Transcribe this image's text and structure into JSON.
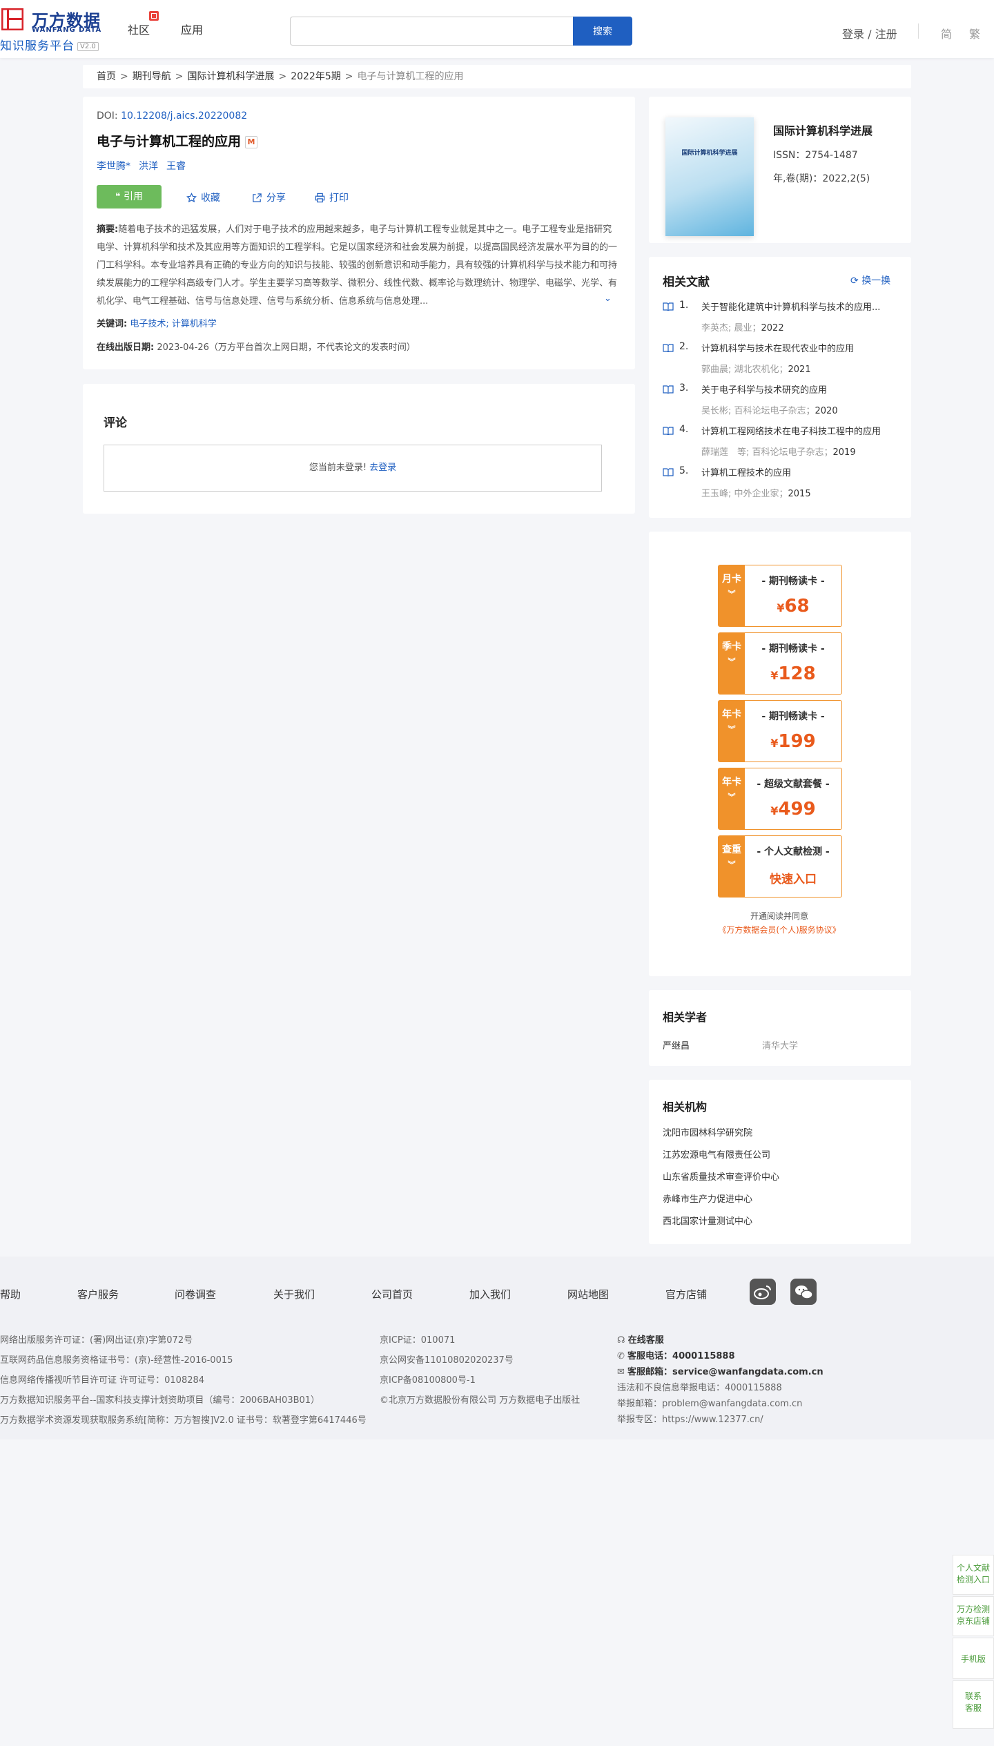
{
  "header": {
    "logo_cn": "万方数据",
    "logo_en": "WANFANG DATA",
    "logo_sub": "知识服务平台",
    "logo_version": "V2.0",
    "nav": [
      "社区",
      "应用"
    ],
    "search_placeholder": "",
    "search_button": "搜索",
    "login": "登录 / 注册",
    "lang_simplified": "简",
    "lang_traditional": "繁"
  },
  "breadcrumb": {
    "items": [
      "首页",
      "期刊导航",
      "国际计算机科学进展",
      "2022年5期"
    ],
    "current": "电子与计算机工程的应用"
  },
  "article": {
    "doi_label": "DOI:",
    "doi": "10.12208/j.aics.20220082",
    "title": "电子与计算机工程的应用",
    "authors": [
      "李世腾*",
      "洪洋",
      "王睿"
    ],
    "actions": {
      "cite": "引用",
      "collect": "收藏",
      "share": "分享",
      "print": "打印"
    },
    "abstract_label": "摘要:",
    "abstract": "随着电子技术的迅猛发展，人们对于电子技术的应用越来越多，电子与计算机工程专业就是其中之一。电子工程专业是指研究电学、计算机科学和技术及其应用等方面知识的工程学科。它是以国家经济和社会发展为前提，以提高国民经济发展水平为目的的一门工科学科。本专业培养具有正确的专业方向的知识与技能、较强的创新意识和动手能力，具有较强的计算机科学与技术能力和可持续发展能力的工程学科高级专门人才。学生主要学习高等数学、微积分、线性代数、概率论与数理统计、物理学、电磁学、光学、有机化学、电气工程基础、信号与信息处理、信号与系统分析、信息系统与信息处理...",
    "keywords_label": "关键词:",
    "keywords": "电子技术; 计算机科学",
    "pubdate_label": "在线出版日期:",
    "pubdate": "2023-04-26",
    "pubdate_note": "（万方平台首次上网日期，不代表论文的发表时间）"
  },
  "comment": {
    "title": "评论",
    "not_logged": "您当前未登录!",
    "login_link": "去登录"
  },
  "journal": {
    "cover_title": "国际计算机科学进展",
    "name": "国际计算机科学进展",
    "issn": "ISSN：2754-1487",
    "year": "年,卷(期)：2022,2(5)"
  },
  "related_docs": {
    "title": "相关文献",
    "switch": "换一换",
    "items": [
      {
        "num": "1.",
        "title": "关于智能化建筑中计算机科学与技术的应用...",
        "meta": "李英杰; 晨业；",
        "year": "2022"
      },
      {
        "num": "2.",
        "title": "计算机科学与技术在现代农业中的应用",
        "meta": "郭曲晨; 湖北农机化；",
        "year": "2021"
      },
      {
        "num": "3.",
        "title": "关于电子科学与技术研究的应用",
        "meta": "吴长彬; 百科论坛电子杂志；",
        "year": "2020"
      },
      {
        "num": "4.",
        "title": "计算机工程网络技术在电子科技工程中的应用",
        "meta": "薛瑞莲　等; 百科论坛电子杂志；",
        "year": "2019"
      },
      {
        "num": "5.",
        "title": "计算机工程技术的应用",
        "meta": "王玉峰; 中外企业家；",
        "year": "2015"
      }
    ]
  },
  "vip": {
    "cards": [
      {
        "side": "月卡",
        "name": "- 期刊畅读卡 -",
        "price": "68"
      },
      {
        "side": "季卡",
        "name": "- 期刊畅读卡 -",
        "price": "128"
      },
      {
        "side": "年卡",
        "name": "- 期刊畅读卡 -",
        "price": "199"
      },
      {
        "side": "年卡",
        "name": "- 超级文献套餐 -",
        "price": "499"
      },
      {
        "side": "查重",
        "name": "- 个人文献检测 -",
        "price": "快速入口"
      }
    ],
    "currency": "¥",
    "note": "开通阅读并同意",
    "agreement": "《万方数据会员(个人)服务协议》"
  },
  "scholars": {
    "title": "相关学者",
    "name": "严继昌",
    "org": "清华大学"
  },
  "institutions": {
    "title": "相关机构",
    "items": [
      "沈阳市园林科学研究院",
      "江苏宏源电气有限责任公司",
      "山东省质量技术审查评价中心",
      "赤峰市生产力促进中心",
      "西北国家计量测试中心"
    ]
  },
  "footer": {
    "links": [
      "帮助",
      "客户服务",
      "问卷调查",
      "关于我们",
      "公司首页",
      "加入我们",
      "网站地图",
      "官方店铺"
    ],
    "licenses": [
      "网络出版服务许可证：(署)网出证(京)字第072号",
      "互联网药品信息服务资格证书号：(京)-经营性-2016-0015",
      "信息网络传播视听节目许可证 许可证号：0108284",
      "万方数据知识服务平台--国家科技支撑计划资助项目（编号：2006BAH03B01）",
      "万方数据学术资源发现获取服务系统[简称：万方智搜]V2.0 证书号：软著登字第6417446号"
    ],
    "icp": [
      "京ICP证：010071",
      "京公网安备11010802020237号",
      "京ICP备08100800号-1",
      "©北京万方数据股份有限公司 万方数据电子出版社"
    ],
    "contact": {
      "online": "在线客服",
      "phone_label": "客服电话：",
      "phone": "4000115888",
      "email_label": "客服邮箱：",
      "email": "service@wanfangdata.com.cn",
      "report_phone": "违法和不良信息举报电话：4000115888",
      "report_email": "举报邮箱：problem@wanfangdata.com.cn",
      "report_area": "举报专区：https://www.12377.cn/"
    }
  },
  "side_float": [
    "个人文献检测入口",
    "万方检测京东店铺",
    "手机版",
    "联系客服"
  ]
}
